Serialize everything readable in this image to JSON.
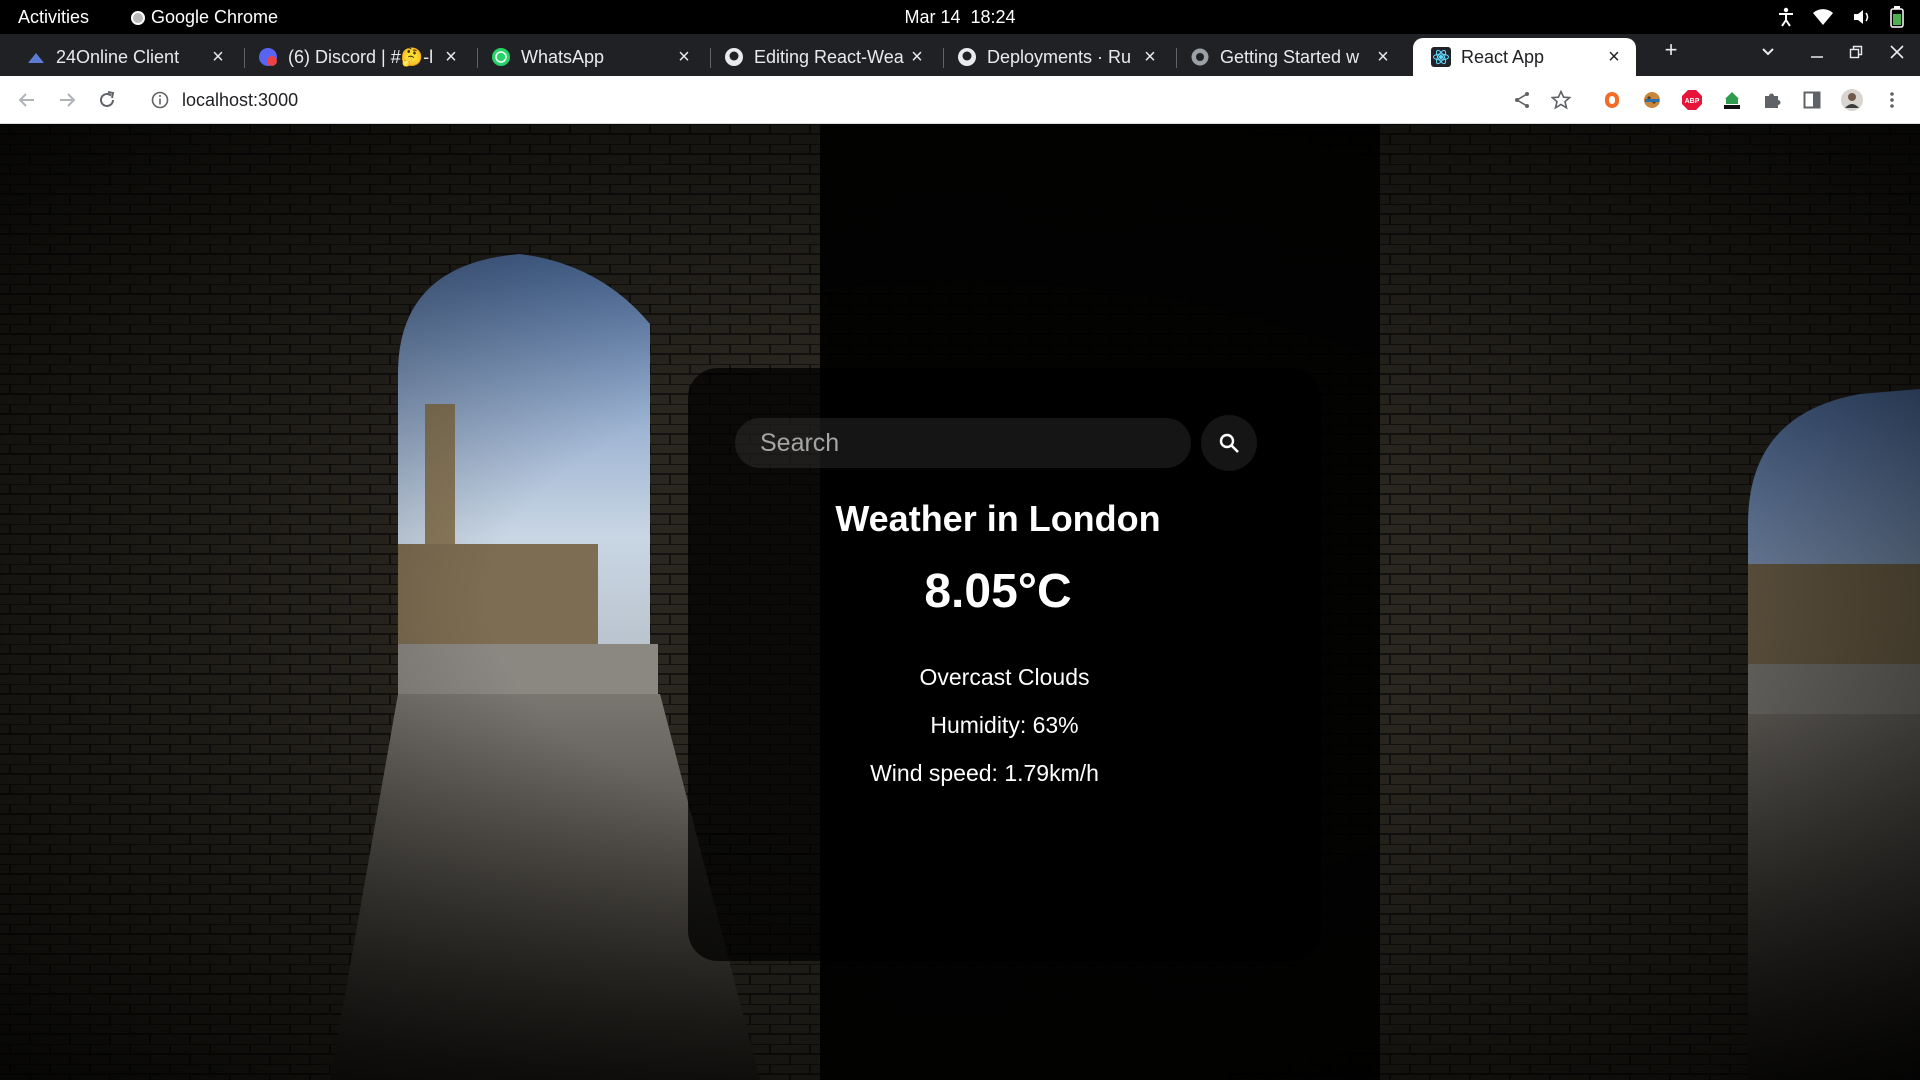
{
  "os_bar": {
    "activities": "Activities",
    "app_name": "Google Chrome",
    "date": "Mar 14",
    "time": "18:24"
  },
  "browser": {
    "tabs": [
      {
        "title": "24Online Client",
        "icon": "24online-favicon",
        "active": false
      },
      {
        "title": "(6) Discord | #🤔-l",
        "icon": "discord-favicon",
        "active": false
      },
      {
        "title": "WhatsApp",
        "icon": "whatsapp-favicon",
        "active": false
      },
      {
        "title": "Editing React-Wea",
        "icon": "github-favicon",
        "active": false
      },
      {
        "title": "Deployments · Ru",
        "icon": "github-favicon",
        "active": false
      },
      {
        "title": "Getting Started w",
        "icon": "globe-favicon",
        "active": false
      },
      {
        "title": "React App",
        "icon": "react-favicon",
        "active": true
      }
    ],
    "new_tab": "+",
    "url": "localhost:3000",
    "extensions": [
      "honey-extension-icon",
      "cookie-extension-icon",
      "adblock-plus-icon",
      "html-extension-icon",
      "extensions-puzzle-icon"
    ],
    "colors": {
      "tabstrip": "#202124",
      "active_tab": "#ffffff",
      "adblock": "#e8153b",
      "whatsapp": "#25d366"
    }
  },
  "weather": {
    "search_placeholder": "Search",
    "title": "Weather in London",
    "temperature": "8.05°C",
    "description": "Overcast Clouds",
    "humidity": "Humidity: 63%",
    "wind": "Wind speed: 1.79km/h"
  }
}
